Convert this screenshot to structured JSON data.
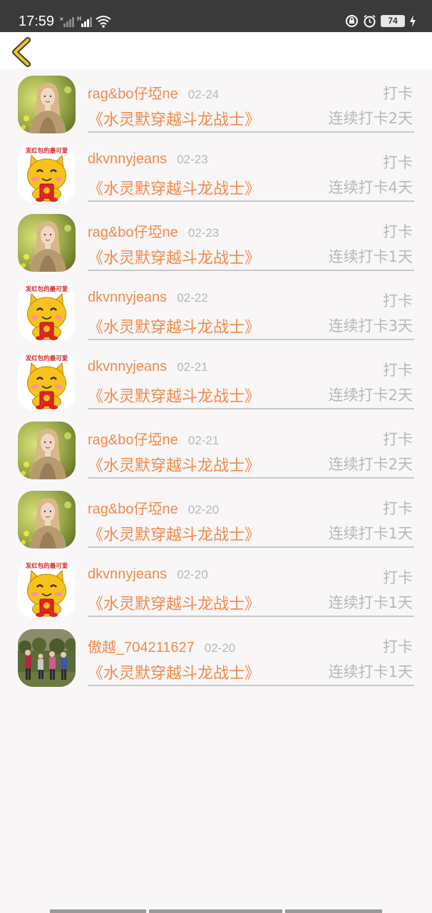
{
  "status_bar": {
    "time": "17:59",
    "battery": "74"
  },
  "colors": {
    "accent": "#f08a4b",
    "muted": "#b8b8b8",
    "status_bar": "#3a3a3a",
    "back_icon": "#f0c419"
  },
  "records": [
    {
      "avatar": "portrait-woman",
      "user": "rag&bo仔埡ne",
      "date": "02-24",
      "action": "打卡",
      "book": "《水灵默穿越斗龙战士》",
      "streak": "连续打卡2天"
    },
    {
      "avatar": "cartoon-cat",
      "user": "dkvnnyjeans",
      "date": "02-23",
      "action": "打卡",
      "book": "《水灵默穿越斗龙战士》",
      "streak": "连续打卡4天"
    },
    {
      "avatar": "portrait-woman",
      "user": "rag&bo仔埡ne",
      "date": "02-23",
      "action": "打卡",
      "book": "《水灵默穿越斗龙战士》",
      "streak": "连续打卡1天"
    },
    {
      "avatar": "cartoon-cat",
      "user": "dkvnnyjeans",
      "date": "02-22",
      "action": "打卡",
      "book": "《水灵默穿越斗龙战士》",
      "streak": "连续打卡3天"
    },
    {
      "avatar": "cartoon-cat",
      "user": "dkvnnyjeans",
      "date": "02-21",
      "action": "打卡",
      "book": "《水灵默穿越斗龙战士》",
      "streak": "连续打卡2天"
    },
    {
      "avatar": "portrait-woman",
      "user": "rag&bo仔埡ne",
      "date": "02-21",
      "action": "打卡",
      "book": "《水灵默穿越斗龙战士》",
      "streak": "连续打卡2天"
    },
    {
      "avatar": "portrait-woman",
      "user": "rag&bo仔埡ne",
      "date": "02-20",
      "action": "打卡",
      "book": "《水灵默穿越斗龙战士》",
      "streak": "连续打卡1天"
    },
    {
      "avatar": "cartoon-cat",
      "user": "dkvnnyjeans",
      "date": "02-20",
      "action": "打卡",
      "book": "《水灵默穿越斗龙战士》",
      "streak": "连续打卡1天"
    },
    {
      "avatar": "group-photo",
      "user": "傲越_704211627",
      "date": "02-20",
      "action": "打卡",
      "book": "《水灵默穿越斗龙战士》",
      "streak": "连续打卡1天"
    }
  ],
  "avatar_text": {
    "cat_banner": "发红包的最可爱"
  }
}
